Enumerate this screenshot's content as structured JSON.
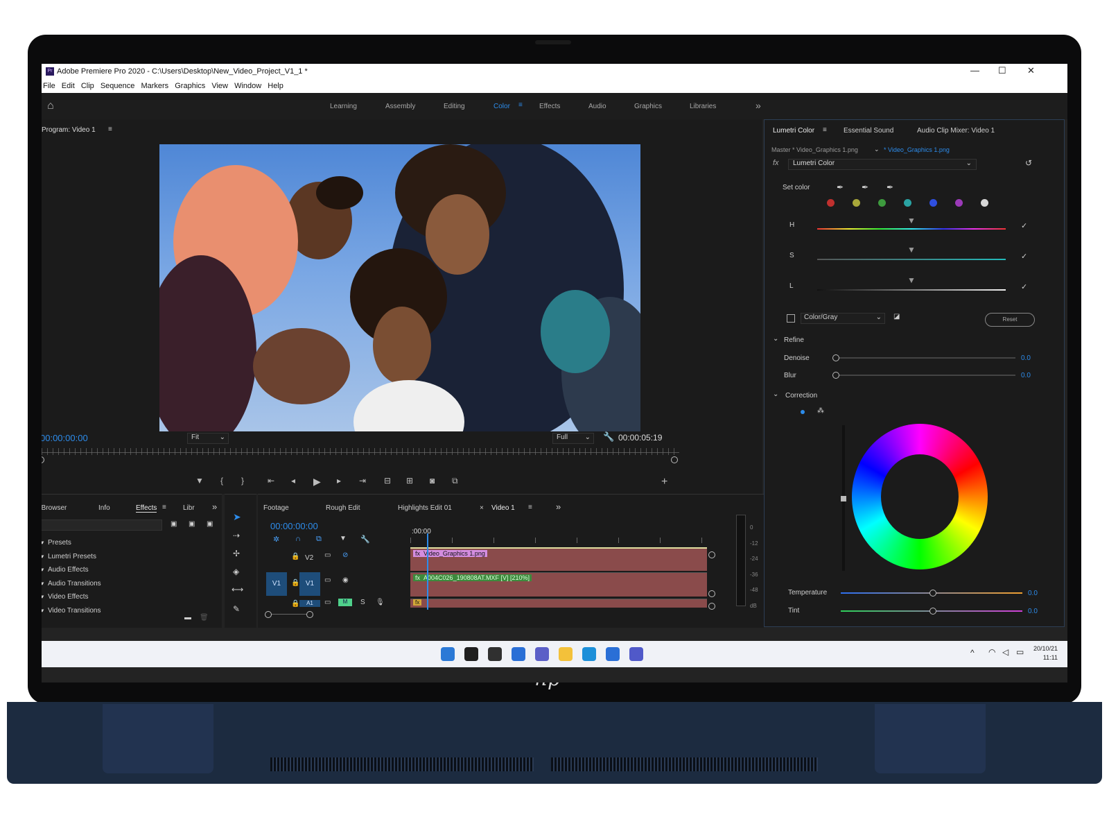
{
  "window": {
    "title": "Adobe Premiere Pro 2020 - C:\\Users\\Desktop\\New_Video_Project_V1_1 *",
    "app_icon": "Pr",
    "controls": [
      "—",
      "☐",
      "✕"
    ]
  },
  "menu": [
    "File",
    "Edit",
    "Clip",
    "Sequence",
    "Markers",
    "Graphics",
    "View",
    "Window",
    "Help"
  ],
  "workspaces": {
    "items": [
      "Learning",
      "Assembly",
      "Editing",
      "Color",
      "Effects",
      "Audio",
      "Graphics",
      "Libraries"
    ],
    "active": "Color",
    "more": "»"
  },
  "program_monitor": {
    "title": "Program: Video 1",
    "timecode_current": "00:00:00:00",
    "zoom": "Fit",
    "quality": "Full",
    "timecode_duration": "00:00:05:19"
  },
  "effects_panel": {
    "tabs": [
      "edia Browser",
      "Info",
      "Effects",
      "Libr"
    ],
    "active_tab": "Effects",
    "items": [
      "Presets",
      "Lumetri Presets",
      "Audio Effects",
      "Audio Transitions",
      "Video Effects",
      "Video Transitions"
    ]
  },
  "timeline": {
    "tabs": [
      "Footage",
      "Rough Edit",
      "Highlights Edit 01",
      "Video 1"
    ],
    "active_tab": "Video 1",
    "close_mark": "×",
    "timecode": "00:00:00:00",
    "ruler_start": ":00:00",
    "tracks": [
      "V2",
      "V1",
      "A1"
    ],
    "source_patch": [
      "V1",
      "A1"
    ],
    "audio_buttons": [
      "M",
      "S"
    ],
    "clips": [
      {
        "name": "Video_Graphics 1.png",
        "fx": "fx"
      },
      {
        "name": "A004C026_190808AT.MXF [V] [210%]",
        "fx": "fx"
      },
      {
        "name": "",
        "fx": "fx"
      }
    ]
  },
  "meter": {
    "scale": [
      "0",
      "-12",
      "-24",
      "-36",
      "-48",
      "dB"
    ]
  },
  "lumetri": {
    "tabs": [
      "Lumetri Color",
      "Essential Sound",
      "Audio Clip Mixer: Video 1"
    ],
    "master": "Master * Video_Graphics 1.png",
    "clip": "* Video_Graphics 1.png",
    "effect": "Lumetri Color",
    "set_color": "Set color",
    "swatches": [
      "#c0302e",
      "#a9a83a",
      "#3d9b3e",
      "#2aa3a3",
      "#2f4fe0",
      "#9b3ab8",
      "#d8d8d8"
    ],
    "hsl": [
      "H",
      "S",
      "L"
    ],
    "color_gray": "Color/Gray",
    "reset": "Reset",
    "refine": "Refine",
    "denoise": {
      "label": "Denoise",
      "value": "0.0"
    },
    "blur": {
      "label": "Blur",
      "value": "0.0"
    },
    "correction": "Correction",
    "temperature": {
      "label": "Temperature",
      "value": "0.0"
    },
    "tint": {
      "label": "Tint",
      "value": "0.0"
    }
  },
  "taskbar": {
    "date": "20/10/21",
    "time": "11:11",
    "app_colors": [
      "#2b79d6",
      "#1f1f1f",
      "#303030",
      "#2a6fd6",
      "#5b5fc7",
      "#f3c13a",
      "#1c8fd9",
      "#2a6fd6",
      "#5059c9"
    ]
  },
  "brand": "hp"
}
